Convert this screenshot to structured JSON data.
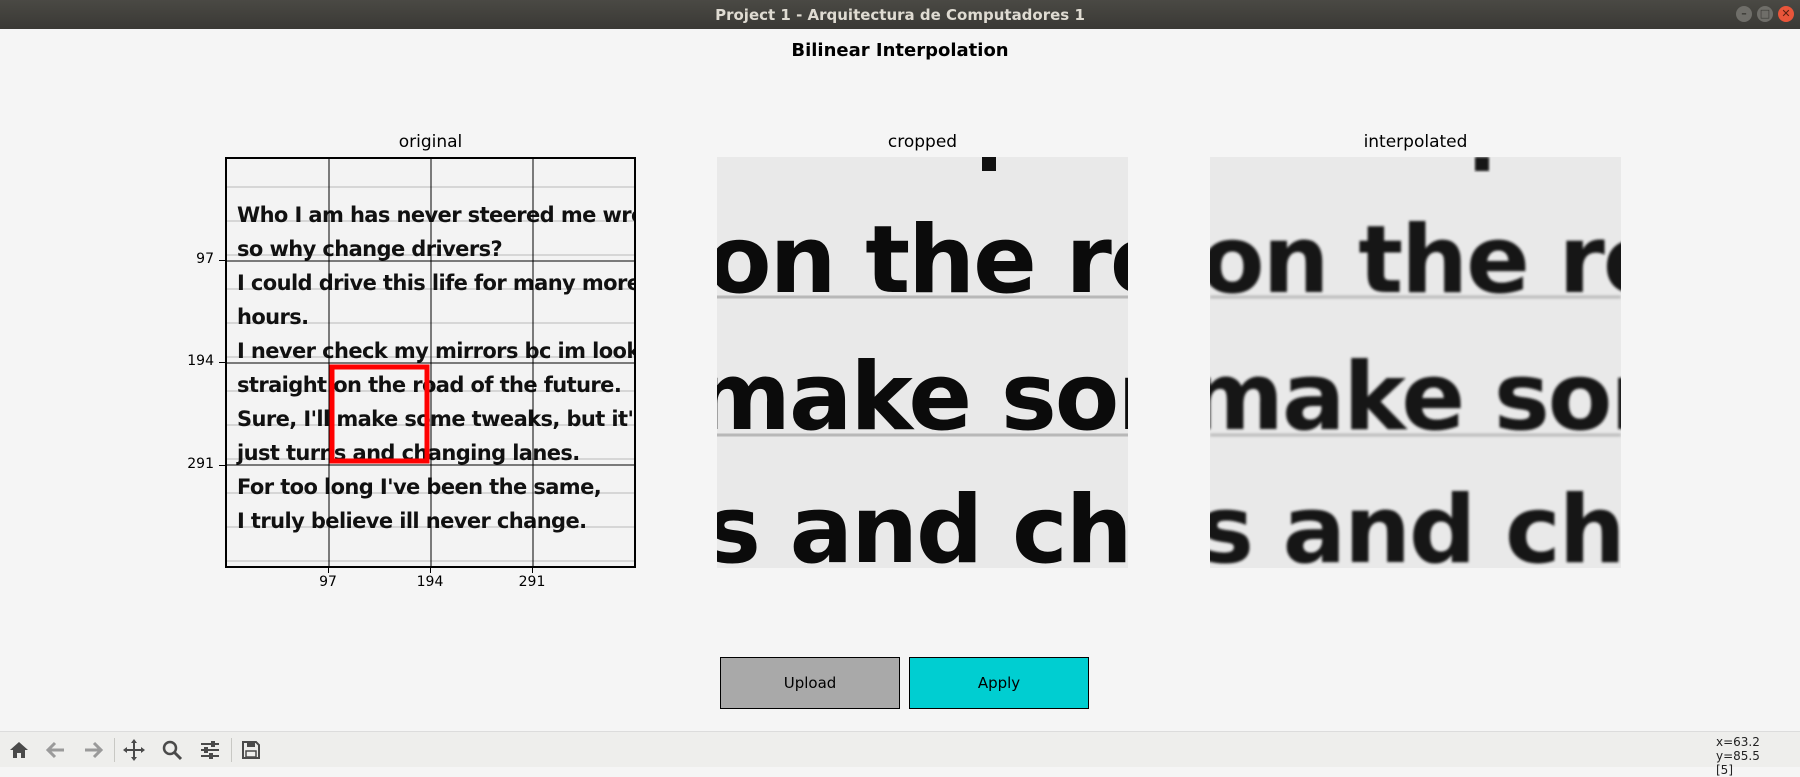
{
  "window": {
    "title": "Project 1 - Arquitectura de Computadores 1",
    "buttons": [
      "minimize-icon",
      "maximize-icon",
      "close-icon"
    ]
  },
  "figure": {
    "suptitle": "Bilinear Interpolation",
    "axes": [
      {
        "title": "original"
      },
      {
        "title": "cropped"
      },
      {
        "title": "interpolated"
      }
    ],
    "original_ticks": {
      "x": [
        "97",
        "194",
        "291"
      ],
      "y": [
        "97",
        "194",
        "291"
      ]
    },
    "selection_box_color": "#ff0000",
    "original_text_lines": [
      "Who I am has never steered me wrong,",
      "so why change drivers?",
      "I could drive this life for many more",
      "hours.",
      "I never check my mirrors bc im looking",
      "straight on the road of the future.",
      "Sure, I'll make some tweaks, but it's just",
      "just turns and changing lanes.",
      "For too long I've been the same,",
      "I truly believe ill never change."
    ],
    "zoom_lines": [
      "on the roac",
      "make some",
      "s and chan"
    ]
  },
  "controls": {
    "upload_label": "Upload",
    "upload_color": "#a9a9a9",
    "apply_label": "Apply",
    "apply_color": "#00ced1"
  },
  "toolbar": {
    "icons": [
      "home-icon",
      "back-icon",
      "forward-icon",
      "pan-icon",
      "zoom-icon",
      "configure-subplots-icon",
      "save-icon"
    ],
    "coords_line1": "x=63.2 y=85.5",
    "coords_line2": "[5]"
  }
}
